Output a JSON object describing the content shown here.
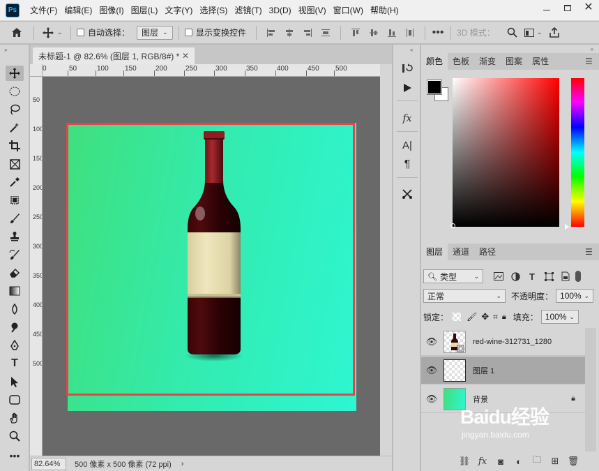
{
  "app": {
    "logo": "Ps"
  },
  "menu": [
    "文件(F)",
    "编辑(E)",
    "图像(I)",
    "图层(L)",
    "文字(Y)",
    "选择(S)",
    "滤镜(T)",
    "3D(D)",
    "视图(V)",
    "窗口(W)",
    "帮助(H)"
  ],
  "options": {
    "auto_select_label": "自动选择：",
    "auto_select_target": "图层",
    "show_transform_label": "显示变换控件",
    "mode_3d": "3D 模式："
  },
  "document": {
    "tab_title": "未标题-1 @ 82.6% (图层 1, RGB/8#) *",
    "zoom": "82.64%",
    "size_info": "500 像素 x 500 像素 (72 ppi)",
    "ruler_h": [
      "0",
      "50",
      "100",
      "150",
      "200",
      "250",
      "300",
      "350",
      "400",
      "450",
      "500"
    ],
    "ruler_v": [
      "50",
      "100",
      "150",
      "200",
      "250",
      "300",
      "350",
      "400",
      "450",
      "500"
    ]
  },
  "color_panel": {
    "tabs": [
      "颜色",
      "色板",
      "渐变",
      "图案",
      "属性"
    ],
    "foreground": "#000000",
    "background": "#ffffff"
  },
  "layers_panel": {
    "tabs": [
      "图层",
      "通道",
      "路径"
    ],
    "filter_label": "类型",
    "blend_mode": "正常",
    "opacity_label": "不透明度：",
    "opacity": "100%",
    "lock_label": "锁定：",
    "fill_label": "填充：",
    "fill": "100%",
    "layers": [
      {
        "name": "red-wine-312731_1280",
        "selected": false
      },
      {
        "name": "图层 1",
        "selected": true
      },
      {
        "name": "背景",
        "selected": false
      }
    ]
  },
  "watermark": {
    "title": "Baidu经验",
    "url": "jingyan.baidu.com"
  }
}
